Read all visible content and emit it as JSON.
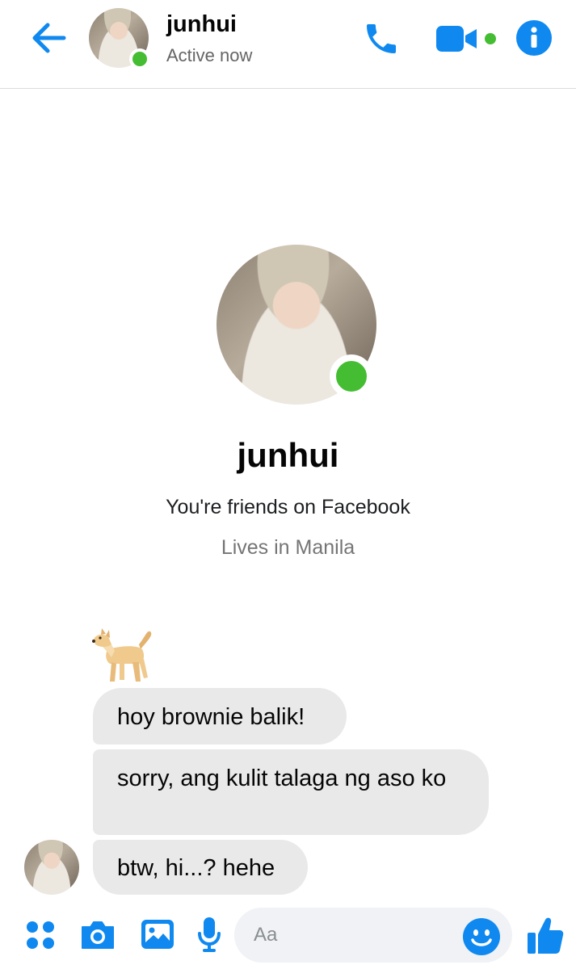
{
  "header": {
    "contact_name": "junhui",
    "status": "Active now",
    "icons": {
      "back": "arrow-left-icon",
      "call": "phone-icon",
      "video": "video-camera-icon",
      "info": "info-icon"
    }
  },
  "intro": {
    "name": "junhui",
    "friendship": "You're friends on Facebook",
    "location": "Lives in Manila"
  },
  "messages": [
    {
      "type": "sticker",
      "sticker": "dog-sticker"
    },
    {
      "type": "text",
      "text": "hoy brownie balik!"
    },
    {
      "type": "text",
      "text": "sorry, ang kulit talaga ng aso ko"
    },
    {
      "type": "text",
      "text": "btw, hi...? hehe"
    }
  ],
  "composer": {
    "placeholder": "Aa",
    "icons": [
      "menu-dots-icon",
      "camera-icon",
      "image-icon",
      "microphone-icon",
      "emoji-icon",
      "thumbs-up-icon"
    ]
  },
  "colors": {
    "accent": "#0f89f0",
    "online": "#45bd33",
    "bubble": "#e9e9e9",
    "secondary_text": "#757575"
  }
}
